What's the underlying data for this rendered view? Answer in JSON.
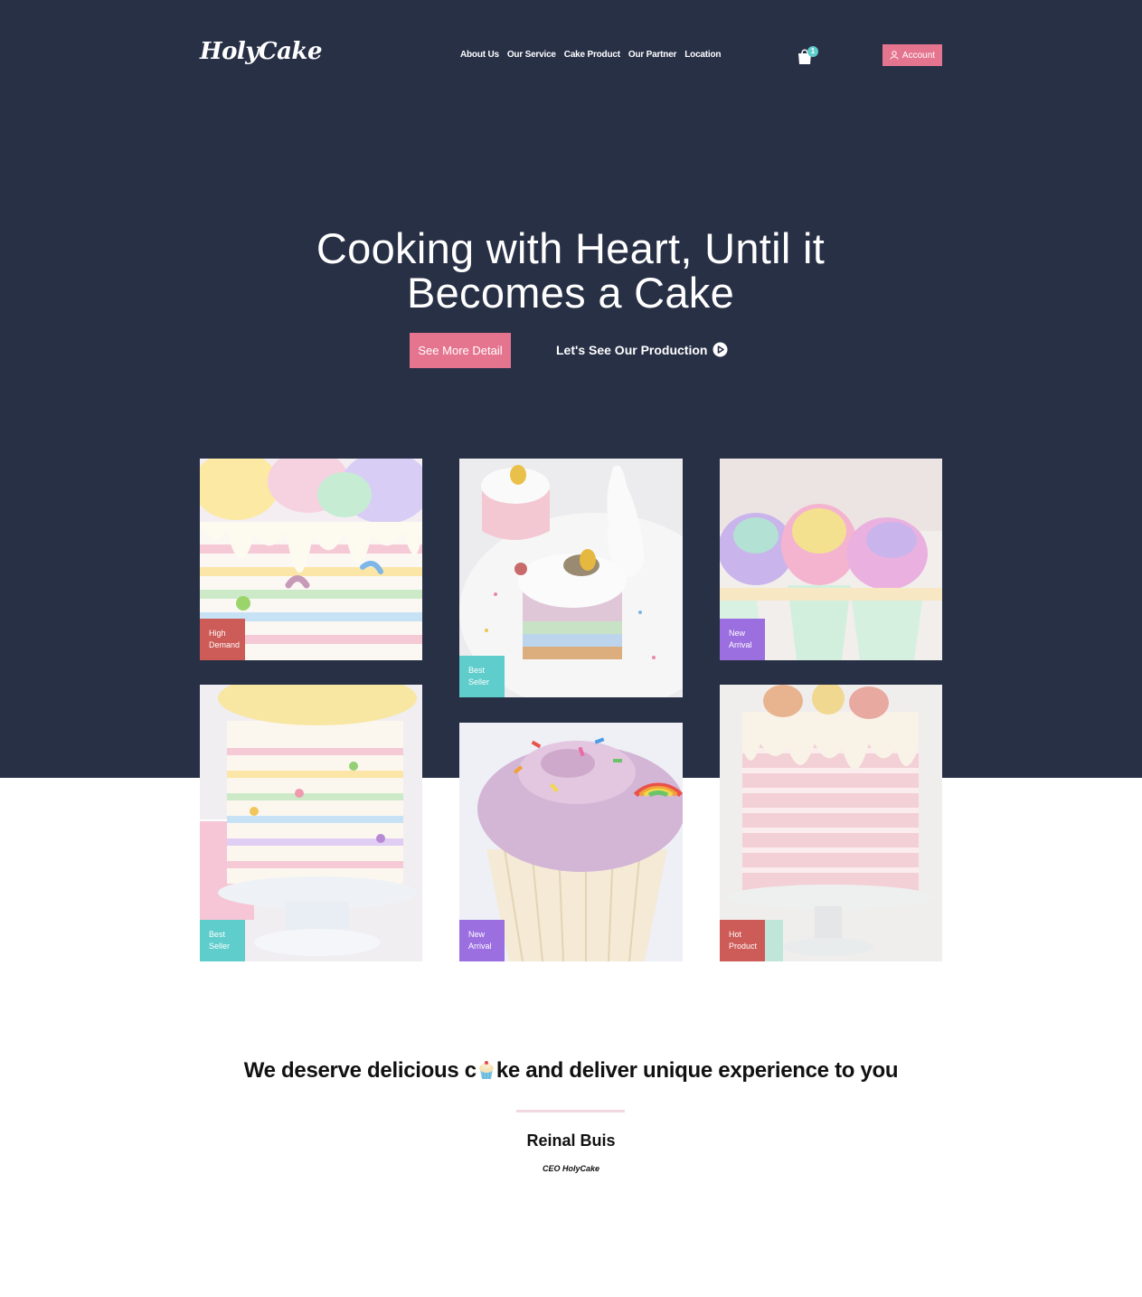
{
  "header": {
    "logo": "HolyCake",
    "nav": [
      "About Us",
      "Our Service",
      "Cake Product",
      "Our Partner",
      "Location"
    ],
    "cart_count": "1",
    "account_label": "Account"
  },
  "hero": {
    "title_line1": "Cooking with Heart, Until it",
    "title_line2": "Becomes a Cake",
    "primary_button": "See More Detail",
    "secondary_button": "Let's See Our Production"
  },
  "gallery": [
    {
      "tag_line1": "High",
      "tag_line2": "Demand",
      "tag_color": "#cd5b57",
      "image": "rainbow-drip-cake"
    },
    {
      "tag_line1": "Best",
      "tag_line2": "Seller",
      "tag_color": "#5ecdcb",
      "image": "easter-mini-cake"
    },
    {
      "tag_line1": "New",
      "tag_line2": "Arrival",
      "tag_color": "#9c6fe0",
      "image": "rainbow-cupcakes"
    },
    {
      "tag_line1": "Best",
      "tag_line2": "Seller",
      "tag_color": "#5ecdcb",
      "image": "striped-pastel-cake"
    },
    {
      "tag_line1": "New",
      "tag_line2": "Arrival",
      "tag_color": "#9c6fe0",
      "image": "sprinkle-cupcake"
    },
    {
      "tag_line1": "Hot",
      "tag_line2": "Product",
      "tag_color": "#cd5b57",
      "image": "pink-macaron-cake"
    }
  ],
  "quote": {
    "before": "We deserve delicious c",
    "after": "ke and deliver unique experience to you",
    "author": "Reinal Buis",
    "role": "CEO HolyCake"
  },
  "colors": {
    "hero_bg": "#283046",
    "accent_pink": "#e5758f",
    "teal": "#5ecdcb",
    "purple": "#9c6fe0",
    "red": "#cd5b57"
  }
}
